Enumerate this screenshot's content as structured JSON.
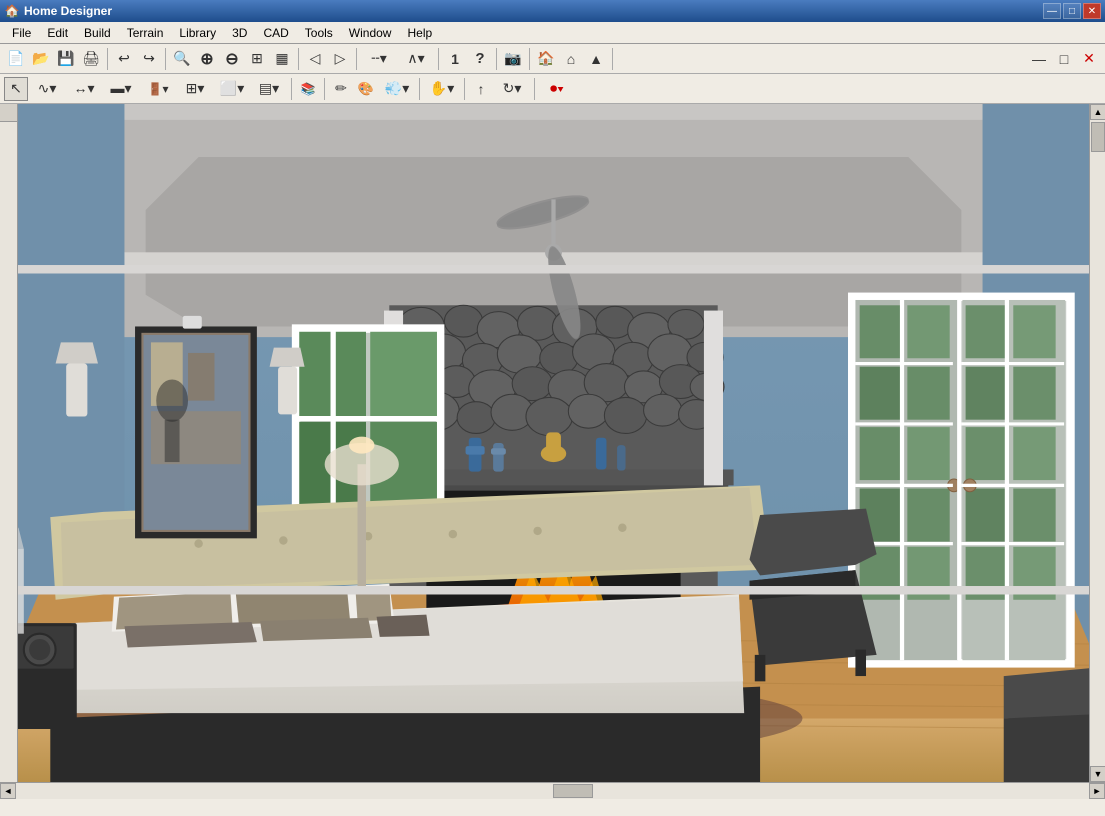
{
  "window": {
    "title": "Home Designer",
    "icon": "🏠"
  },
  "titlebar": {
    "minimize_label": "—",
    "restore_label": "□",
    "close_label": "✕"
  },
  "menu": {
    "items": [
      {
        "id": "file",
        "label": "File"
      },
      {
        "id": "edit",
        "label": "Edit"
      },
      {
        "id": "build",
        "label": "Build"
      },
      {
        "id": "terrain",
        "label": "Terrain"
      },
      {
        "id": "library",
        "label": "Library"
      },
      {
        "id": "3d",
        "label": "3D"
      },
      {
        "id": "cad",
        "label": "CAD"
      },
      {
        "id": "tools",
        "label": "Tools"
      },
      {
        "id": "window",
        "label": "Window"
      },
      {
        "id": "help",
        "label": "Help"
      }
    ]
  },
  "toolbar1": {
    "buttons": [
      {
        "id": "new",
        "icon": "📄",
        "tooltip": "New"
      },
      {
        "id": "open",
        "icon": "📂",
        "tooltip": "Open"
      },
      {
        "id": "save",
        "icon": "💾",
        "tooltip": "Save"
      },
      {
        "id": "print",
        "icon": "🖨",
        "tooltip": "Print"
      },
      {
        "id": "undo",
        "icon": "↩",
        "tooltip": "Undo"
      },
      {
        "id": "redo",
        "icon": "↪",
        "tooltip": "Redo"
      },
      {
        "id": "zoom-in-small",
        "icon": "🔍",
        "tooltip": "Zoom In Small"
      },
      {
        "id": "zoom-in",
        "icon": "⊕",
        "tooltip": "Zoom In"
      },
      {
        "id": "zoom-out",
        "icon": "⊖",
        "tooltip": "Zoom Out"
      },
      {
        "id": "fit",
        "icon": "⊞",
        "tooltip": "Fit"
      },
      {
        "id": "fill",
        "icon": "▦",
        "tooltip": "Fill"
      },
      {
        "id": "prev-view",
        "icon": "◁",
        "tooltip": "Previous View"
      },
      {
        "id": "next-view",
        "icon": "▷",
        "tooltip": "Next View"
      },
      {
        "id": "line-style",
        "icon": "╌",
        "tooltip": "Line Style"
      },
      {
        "id": "angle",
        "icon": "∧",
        "tooltip": "Angle"
      },
      {
        "id": "dimension",
        "icon": "1",
        "tooltip": "Dimension"
      },
      {
        "id": "help",
        "icon": "?",
        "tooltip": "Help"
      },
      {
        "id": "camera",
        "icon": "📷",
        "tooltip": "Camera"
      },
      {
        "id": "house1",
        "icon": "🏠",
        "tooltip": "House View 1"
      },
      {
        "id": "house2",
        "icon": "⌂",
        "tooltip": "House View 2"
      },
      {
        "id": "house3",
        "icon": "▲",
        "tooltip": "House View 3"
      }
    ]
  },
  "toolbar2": {
    "buttons": [
      {
        "id": "select",
        "icon": "↖",
        "tooltip": "Select"
      },
      {
        "id": "draw-line",
        "icon": "∿",
        "tooltip": "Draw Line"
      },
      {
        "id": "measure",
        "icon": "↔",
        "tooltip": "Measure"
      },
      {
        "id": "wall",
        "icon": "▬",
        "tooltip": "Wall"
      },
      {
        "id": "door",
        "icon": "🚪",
        "tooltip": "Door"
      },
      {
        "id": "save2",
        "icon": "⊞",
        "tooltip": "Save View"
      },
      {
        "id": "window-tool",
        "icon": "⬜",
        "tooltip": "Window"
      },
      {
        "id": "stairs",
        "icon": "▤",
        "tooltip": "Stairs"
      },
      {
        "id": "library2",
        "icon": "📚",
        "tooltip": "Library"
      },
      {
        "id": "pencil",
        "icon": "✏",
        "tooltip": "Pencil"
      },
      {
        "id": "paint",
        "icon": "🖌",
        "tooltip": "Paint"
      },
      {
        "id": "spray",
        "icon": "💨",
        "tooltip": "Spray"
      },
      {
        "id": "hand",
        "icon": "✋",
        "tooltip": "Hand"
      },
      {
        "id": "arrow",
        "icon": "↑",
        "tooltip": "Arrow"
      },
      {
        "id": "rotate",
        "icon": "↻",
        "tooltip": "Rotate"
      },
      {
        "id": "rec",
        "icon": "⏺",
        "tooltip": "Record"
      }
    ]
  },
  "viewport": {
    "scene_description": "3D bedroom interior with fireplace, bed, windows, and French doors"
  },
  "statusbar": {
    "text": ""
  }
}
